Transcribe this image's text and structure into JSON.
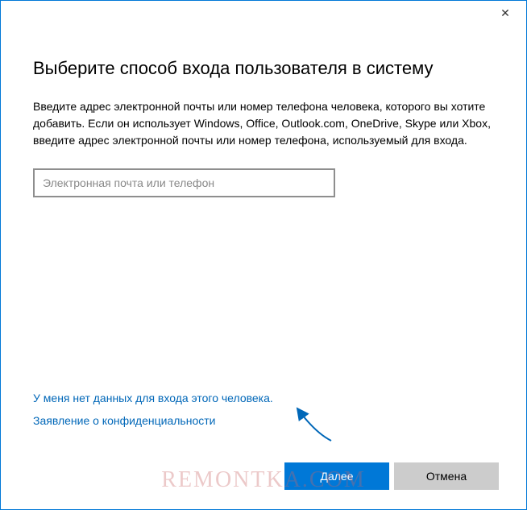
{
  "titlebar": {
    "close_symbol": "✕"
  },
  "main": {
    "heading": "Выберите способ входа пользователя в систему",
    "description": "Введите адрес электронной почты или номер телефона человека, которого вы хотите добавить. Если он использует Windows, Office, Outlook.com, OneDrive, Skype или Xbox, введите адрес электронной почты или номер телефона, используемый для входа.",
    "input_placeholder": "Электронная почта или телефон",
    "input_value": ""
  },
  "links": {
    "no_signin_data": "У меня нет данных для входа этого человека.",
    "privacy": "Заявление о конфиденциальности"
  },
  "buttons": {
    "next": "Далее",
    "cancel": "Отмена"
  },
  "watermark": "REMONTKA.COM"
}
